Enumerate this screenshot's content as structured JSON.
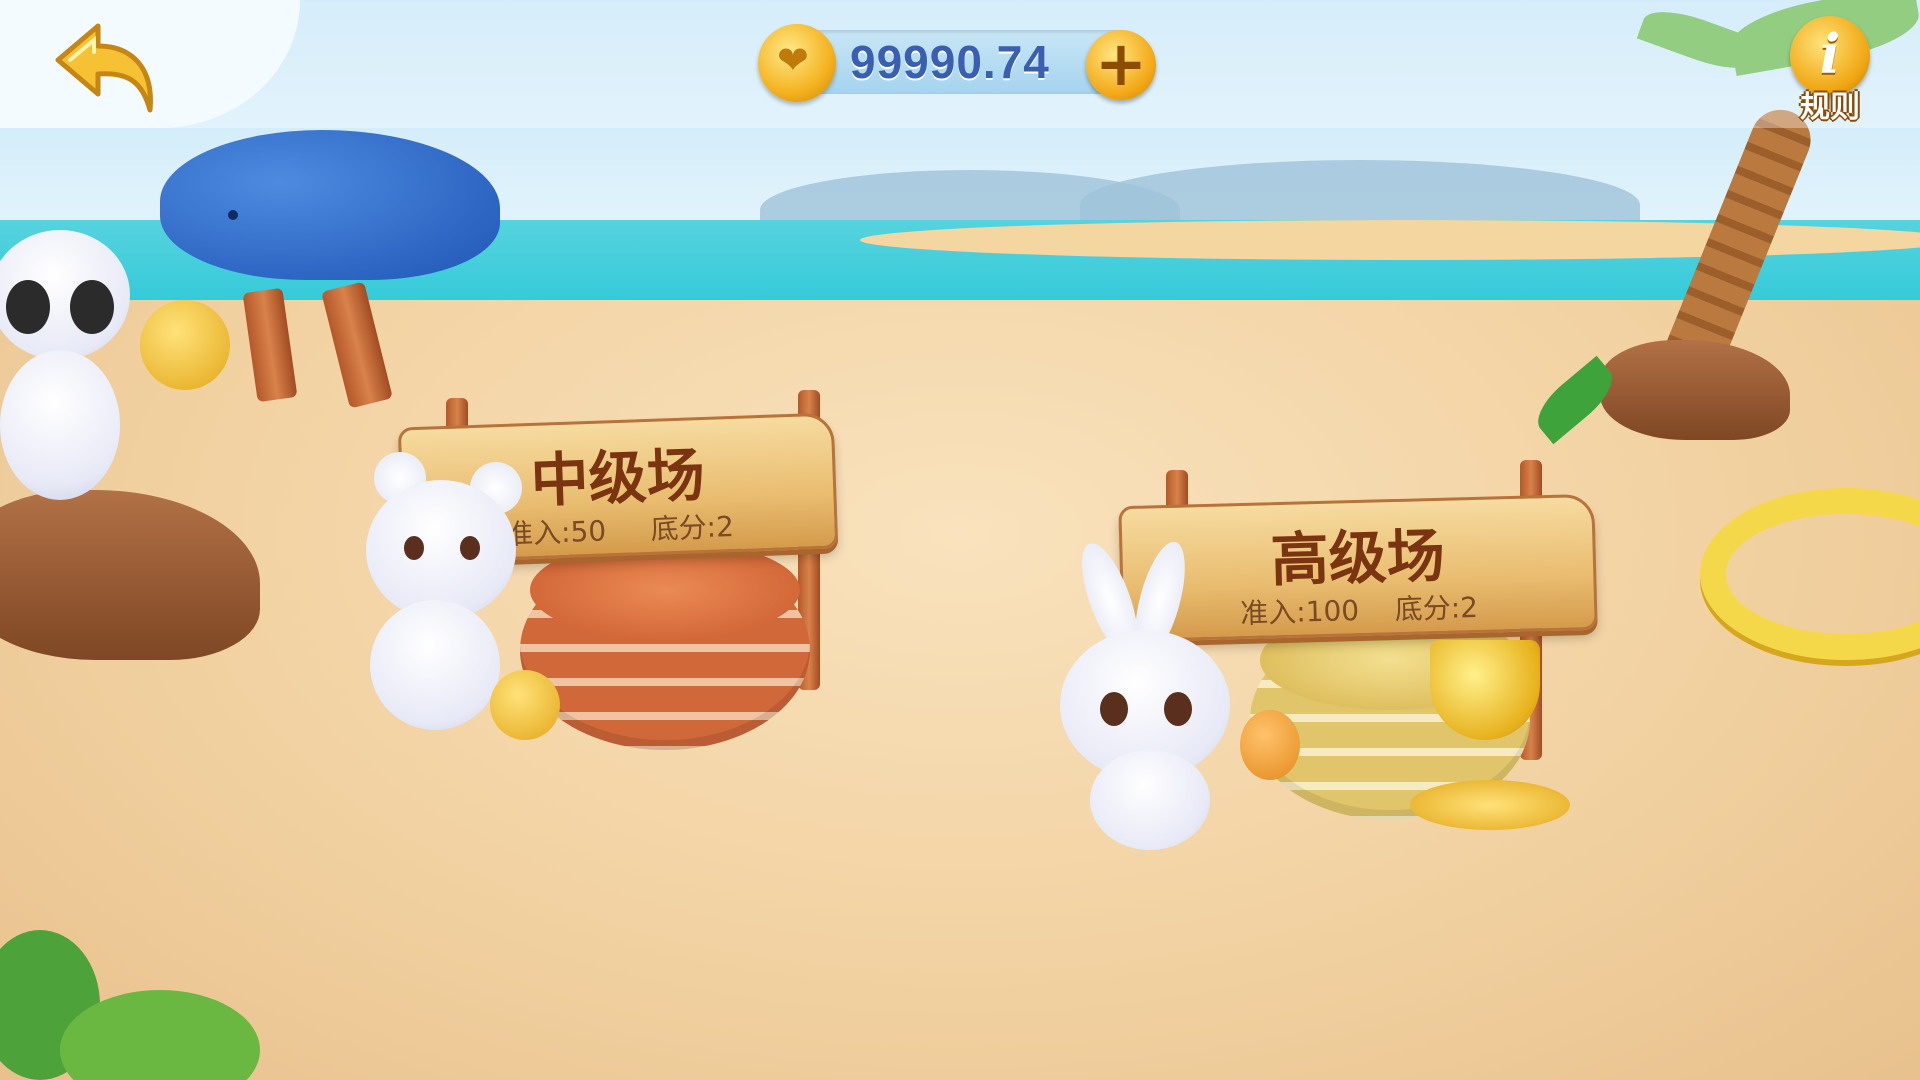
{
  "topbar": {
    "balance": "99990.74",
    "coin_symbol": "❤",
    "add_symbol": "+",
    "rules_icon": "i",
    "rules_label": "规则"
  },
  "rooms": [
    {
      "title": "中级场",
      "entry": "准入:50",
      "base": "底分:2",
      "chip_color": "#d0683a",
      "mascot": "white-bear"
    },
    {
      "title": "高级场",
      "entry": "准入:100",
      "base": "底分:2",
      "chip_color": "#e0c56a",
      "mascot": "white-rabbit"
    }
  ],
  "icons": {
    "back": "back-arrow-icon",
    "coin": "gold-coin-icon",
    "add": "plus-icon",
    "rules": "info-icon"
  }
}
